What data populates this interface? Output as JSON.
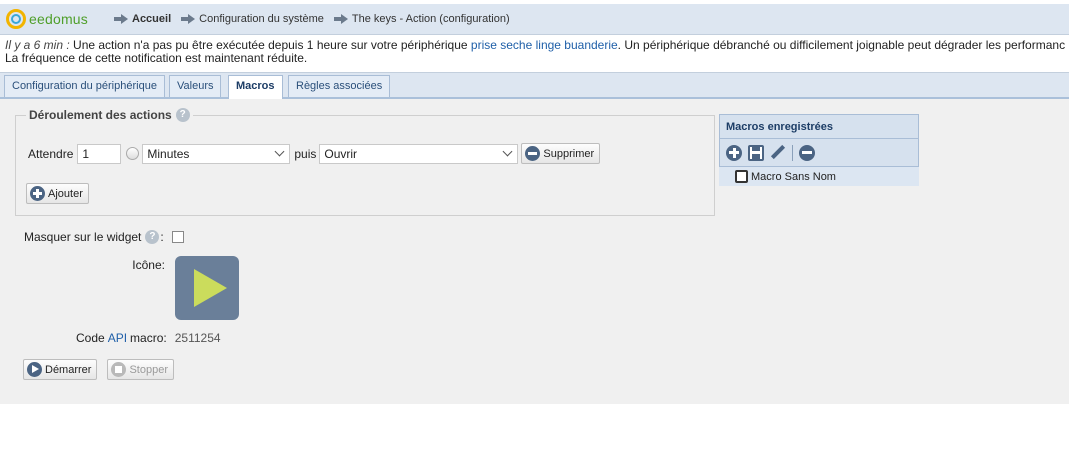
{
  "header": {
    "logo_text": "eedomus",
    "breadcrumbs": [
      "Accueil",
      "Configuration du système",
      "The keys - Action (configuration)"
    ]
  },
  "notification": {
    "time": "Il y a 6 min :",
    "text_before": " Une action n'a pas pu être exécutée depuis 1 heure sur votre périphérique ",
    "link": "prise seche linge buanderie",
    "text_after": ". Un périphérique débranché ou difficilement joignable peut dégrader les performanc",
    "line2": "La fréquence de cette notification est maintenant réduite."
  },
  "tabs": [
    {
      "label": "Configuration du périphérique",
      "active": false
    },
    {
      "label": "Valeurs",
      "active": false
    },
    {
      "label": "Macros",
      "active": true
    },
    {
      "label": "Règles associées",
      "active": false
    }
  ],
  "actions": {
    "legend": "Déroulement des actions",
    "wait_label": "Attendre",
    "wait_value": "1",
    "unit_value": "Minutes",
    "then_label": "puis",
    "action_value": "Ouvrir",
    "delete_label": "Supprimer",
    "add_label": "Ajouter"
  },
  "macros_panel": {
    "title": "Macros enregistrées",
    "items": [
      "Macro Sans Nom"
    ]
  },
  "form": {
    "mask_label": "Masquer sur le widget",
    "mask_checked": false,
    "icon_label": "Icône:",
    "api_prefix": "Code",
    "api_link": "API",
    "api_suffix": "macro:",
    "api_value": "2511254",
    "start_label": "Démarrer",
    "stop_label": "Stopper"
  },
  "colors": {
    "header_bg": "#dde6f1",
    "accent_blue": "#4b6483",
    "link": "#1f5fa8",
    "play_tile": "#6a7f99",
    "play_triangle": "#cbdc5c"
  }
}
